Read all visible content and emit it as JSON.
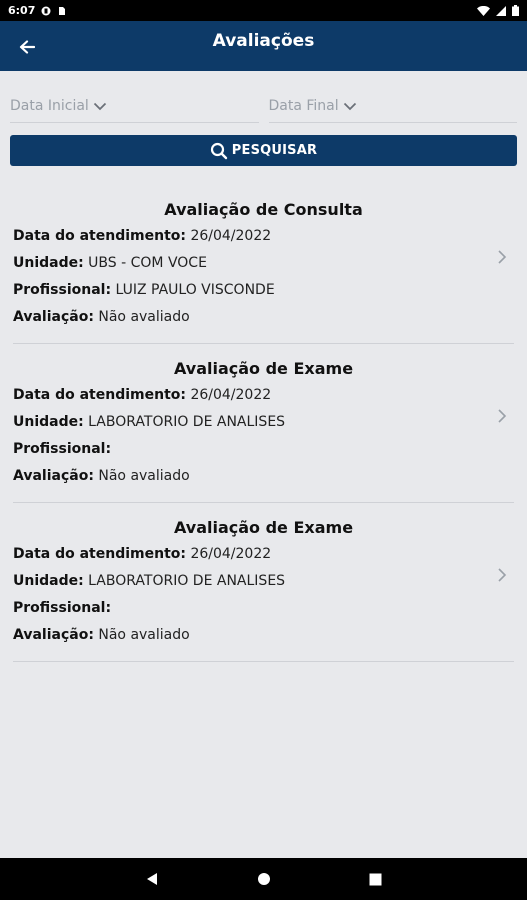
{
  "status_bar": {
    "time": "6:07"
  },
  "header": {
    "title": "Avaliações"
  },
  "filters": {
    "start_date": "Data Inicial",
    "end_date": "Data Final"
  },
  "search_button": {
    "label": "PESQUISAR"
  },
  "labels": {
    "date": "Data do atendimento:",
    "unit": "Unidade:",
    "professional": "Profissional:",
    "evaluation": "Avaliação:"
  },
  "items": [
    {
      "title": "Avaliação de Consulta",
      "date": "26/04/2022",
      "unit": "UBS - COM VOCE",
      "professional": "LUIZ PAULO VISCONDE",
      "evaluation": "Não avaliado"
    },
    {
      "title": "Avaliação de Exame",
      "date": "26/04/2022",
      "unit": "LABORATORIO DE ANALISES",
      "professional": "",
      "evaluation": "Não avaliado"
    },
    {
      "title": "Avaliação de Exame",
      "date": "26/04/2022",
      "unit": "LABORATORIO DE ANALISES",
      "professional": "",
      "evaluation": "Não avaliado"
    }
  ],
  "colors": {
    "primary": "#0d3a68",
    "background": "#e8e9ec"
  }
}
